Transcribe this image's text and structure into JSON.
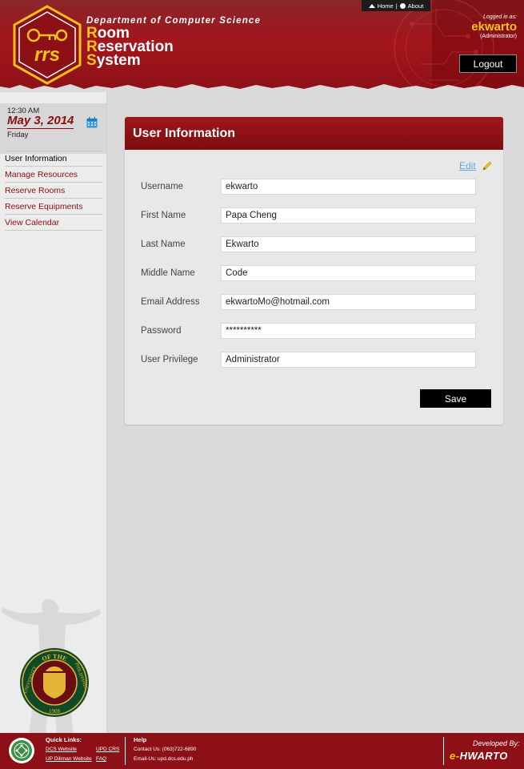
{
  "header": {
    "department": "Department of Computer Science",
    "system_title": [
      {
        "initial": "R",
        "rest": "oom"
      },
      {
        "initial": "R",
        "rest": "eservation"
      },
      {
        "initial": "S",
        "rest": "ystem"
      }
    ],
    "logo_text": "rrs",
    "topnav": {
      "home": "Home",
      "separator": "|",
      "about": "About"
    },
    "logged_in_label": "Logged in as:",
    "username": "ekwarto",
    "role": "(Administrator)",
    "logout_label": "Logout"
  },
  "sidebar": {
    "time": "12:30 AM",
    "date": "May 3, 2014",
    "day": "Friday",
    "menu": [
      "User Information",
      "Manage Resources",
      "Reserve Rooms",
      "Reserve Equipments",
      "View Calendar"
    ],
    "seal_top_text": "OF THE",
    "seal_left_text": "UNIVERSITY",
    "seal_right_text": "PHILIPPINES",
    "seal_year": "1908"
  },
  "panel": {
    "title": "User Information",
    "edit_label": "Edit",
    "fields": [
      {
        "label": "Username",
        "value": "ekwarto"
      },
      {
        "label": "First Name",
        "value": "Papa Cheng"
      },
      {
        "label": "Last Name",
        "value": "Ekwarto"
      },
      {
        "label": "Middle Name",
        "value": "Code"
      },
      {
        "label": "Email Address",
        "value": "ekwartoMo@hotmail.com"
      },
      {
        "label": "Password",
        "value": "**********"
      },
      {
        "label": "User Privilege",
        "value": "Administrator"
      }
    ],
    "save_label": "Save"
  },
  "footer": {
    "quick_links_title": "Quick Links:",
    "links": [
      "DCS Website",
      "UPD CRS",
      "UP Diliman Website",
      "FAQ"
    ],
    "help_title": "Help",
    "contact": "Contact Us: (063)722-6890",
    "email": "Email-Us: upd.dcs.edu.ph",
    "developed_by": "Developed By:",
    "developer_logo": {
      "prefix": "e-",
      "name": "HWARTO"
    }
  },
  "colors": {
    "brand_red": "#8c1015",
    "accent_yellow": "#f4c21b",
    "link_blue": "#5aa9e6"
  }
}
